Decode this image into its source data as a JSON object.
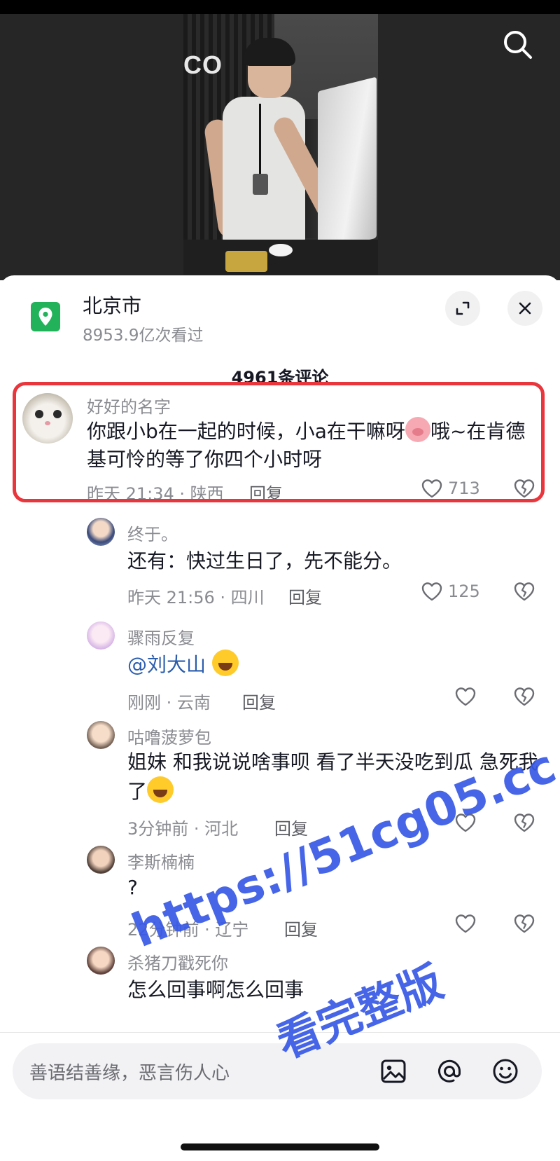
{
  "location": {
    "name": "北京市",
    "views": "8953.9亿次看过"
  },
  "comment_count": "4961条评论",
  "comments": [
    {
      "username": "好好的名字",
      "text_before": "你跟小b在一起的时候，小a在干嘛呀",
      "emoji": "pig-face-emoji",
      "text_after": "哦~在肯德基可怜的等了你四个小时呀",
      "time_place": "昨天 21:34 · 陕西",
      "reply_label": "回复",
      "likes": "713",
      "highlighted": true
    },
    {
      "username": "终于。",
      "text": "还有：快过生日了，先不能分。",
      "time_place": "昨天 21:56 · 四川",
      "reply_label": "回复",
      "likes": "125"
    },
    {
      "username": "骤雨反复",
      "mention": "@刘大山",
      "emoji": "laughing-tears-emoji",
      "time_place": "刚刚 · 云南",
      "reply_label": "回复",
      "likes": ""
    },
    {
      "username": "咕噜菠萝包",
      "text": "姐妹 和我说说啥事呗 看了半天没吃到瓜 急死我了",
      "emoji": "laughing-tears-emoji",
      "time_place": "3分钟前 · 河北",
      "reply_label": "回复",
      "likes": ""
    },
    {
      "username": "李斯楠楠",
      "text": "?",
      "time_place": "22分钟前 · 辽宁",
      "reply_label": "回复",
      "likes": ""
    },
    {
      "username": "杀猪刀戳死你",
      "text": "怎么回事啊怎么回事"
    }
  ],
  "input": {
    "placeholder": "善语结善缘，恶言伤人心"
  },
  "icons": {
    "search": "search-icon",
    "location": "location-pin-icon",
    "expand": "expand-icon",
    "close": "close-icon",
    "like": "heart-icon",
    "dislike": "broken-heart-icon",
    "image": "image-icon",
    "at": "at-icon",
    "emoji": "emoji-icon"
  },
  "colors": {
    "location_green": "#21b25a",
    "highlight_red": "#e9353c",
    "mention_blue": "#2b5dad",
    "watermark_blue": "#3759e6"
  },
  "watermark": {
    "url": "https://51cg05.cc",
    "cta": "看完整版"
  }
}
